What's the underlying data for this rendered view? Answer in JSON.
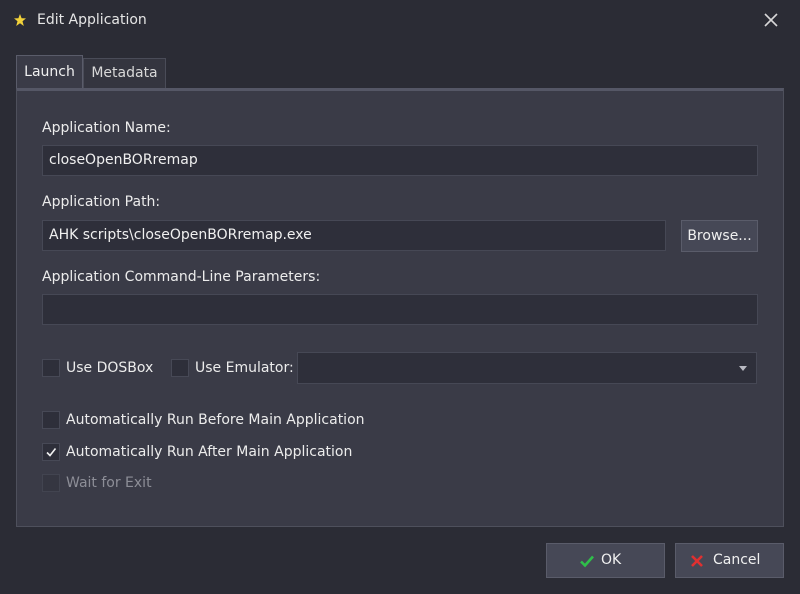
{
  "window": {
    "title": "Edit Application",
    "icon": "yellow-star-icon"
  },
  "tabs": [
    {
      "label": "Launch",
      "active": true
    },
    {
      "label": "Metadata",
      "active": false
    }
  ],
  "form": {
    "app_name_label": "Application Name:",
    "app_name_value": "closeOpenBORremap",
    "app_path_label": "Application Path:",
    "app_path_value": "AHK scripts\\closeOpenBORremap.exe",
    "browse_label": "Browse...",
    "cmdline_label": "Application Command-Line Parameters:",
    "cmdline_value": "",
    "use_dosbox_label": "Use DOSBox",
    "use_dosbox_checked": false,
    "use_emulator_label": "Use Emulator:",
    "use_emulator_checked": false,
    "emulator_value": "",
    "run_before_label": "Automatically Run Before Main Application",
    "run_before_checked": false,
    "run_after_label": "Automatically Run After Main Application",
    "run_after_checked": true,
    "wait_exit_label": "Wait for Exit",
    "wait_exit_checked": false,
    "wait_exit_enabled": false
  },
  "buttons": {
    "ok_label": "OK",
    "cancel_label": "Cancel"
  },
  "colors": {
    "ok_icon": "#2fbf4a",
    "cancel_icon": "#e03030",
    "icon_star": "#f2d23a"
  }
}
